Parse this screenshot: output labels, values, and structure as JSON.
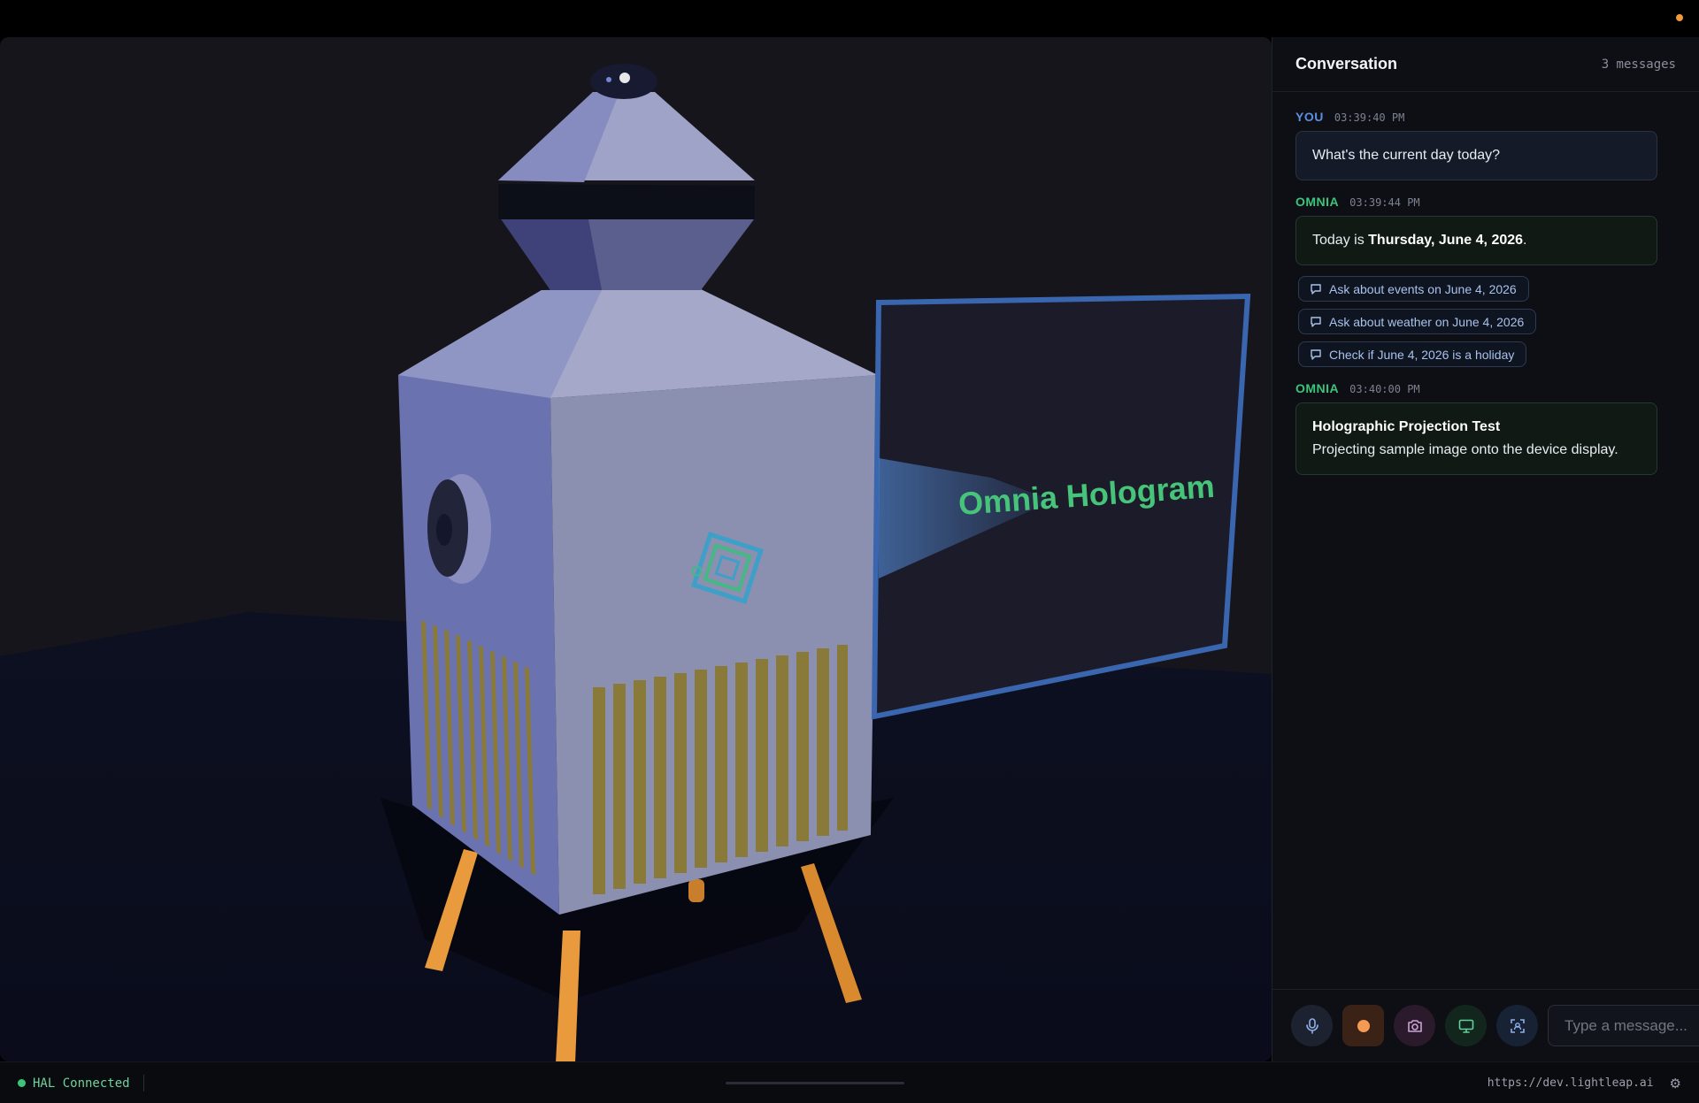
{
  "scene": {
    "hologram_text": "Omnia Hologram",
    "colors": {
      "screen_border": "#3a66b0",
      "hologram_text": "#46c47a",
      "legs": "#e89a3c",
      "vents": "#8a7a3a"
    }
  },
  "panel": {
    "title": "Conversation",
    "count": "3 messages",
    "messages": [
      {
        "author": "YOU",
        "time": "03:39:40 PM",
        "text": "What's the current day today?"
      },
      {
        "author": "OMNIA",
        "time": "03:39:44 PM",
        "text_prefix": "Today is ",
        "text_bold": "Thursday, June 4, 2026",
        "text_suffix": ".",
        "suggestions": [
          "Ask about events on June 4, 2026",
          "Ask about weather on June 4, 2026",
          "Check if June 4, 2026 is a holiday"
        ]
      },
      {
        "author": "OMNIA",
        "time": "03:40:00 PM",
        "card_title": "Holographic Projection Test",
        "card_body": "Projecting sample image onto the device display."
      }
    ]
  },
  "composer": {
    "placeholder": "Type a message...",
    "icons": [
      "microphone-icon",
      "record-icon",
      "camera-icon",
      "monitor-icon",
      "scan-icon"
    ]
  },
  "status": {
    "connection": "HAL Connected",
    "url": "https://dev.lightleap.ai"
  }
}
